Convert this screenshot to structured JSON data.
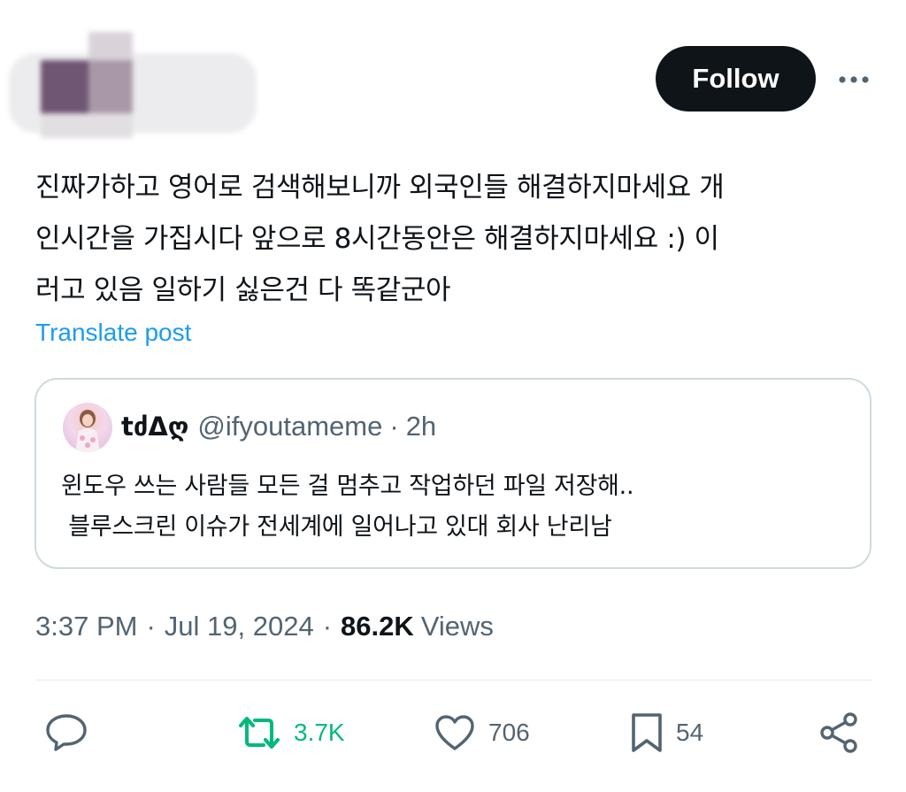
{
  "header": {
    "follow_label": "Follow"
  },
  "post": {
    "text_lines": [
      "진짜가하고 영어로 검색해보니까 외국인들 해결하지마세요 개",
      "인시간을 가집시다 앞으로 8시간동안은 해결하지마세요 :) 이",
      "러고 있음 일하기 싫은건 다 똑같군아"
    ],
    "translate_label": "Translate post"
  },
  "quote": {
    "name": "tძΔღ",
    "handle": "@ifyoutameme",
    "separator": "·",
    "time": "2h",
    "text_lines": [
      "윈도우 쓰는 사람들 모든 걸 멈추고 작업하던 파일 저장해..",
      " 블루스크린 이슈가 전세계에 일어나고 있대 회사 난리남"
    ]
  },
  "meta": {
    "time": "3:37 PM",
    "separator": "·",
    "date": "Jul 19, 2024",
    "views_count": "86.2K",
    "views_label": "Views"
  },
  "actions": {
    "reply_count": "",
    "retweet_count": "3.7K",
    "like_count": "706",
    "bookmark_count": "54"
  },
  "icons": {
    "more": "more-horizontal-icon",
    "reply": "reply-icon",
    "retweet": "retweet-icon",
    "like": "heart-icon",
    "bookmark": "bookmark-icon",
    "share": "share-icon"
  },
  "colors": {
    "text": "#0f1419",
    "secondary": "#536471",
    "link": "#1d9bf0",
    "retweet_green": "#00ba7c",
    "border": "#cfd9de"
  }
}
